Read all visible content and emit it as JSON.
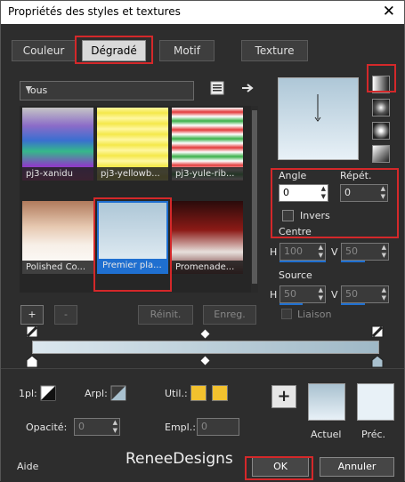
{
  "window": {
    "title": "Propriétés des styles et textures",
    "close_glyph": "✕"
  },
  "tabs": [
    {
      "label": "Couleur"
    },
    {
      "label": "Dégradé",
      "selected": true
    },
    {
      "label": "Motif"
    },
    {
      "label": "Texture"
    }
  ],
  "library": {
    "category": "Tous",
    "items": [
      {
        "label": "pj3-xanidu"
      },
      {
        "label": "pj3-yellowb..."
      },
      {
        "label": "pj3-yule-rib..."
      },
      {
        "label": "Polished Co..."
      },
      {
        "label": "Premier pla...",
        "selected": true
      },
      {
        "label": "Promenade..."
      }
    ]
  },
  "options": {
    "angle_label": "Angle",
    "angle_value": "0",
    "repeat_label": "Répét.",
    "repeat_value": "0",
    "invert_label": "Invers",
    "center_label": "Centre",
    "center_h_label": "H",
    "center_h_value": "100",
    "center_v_label": "V",
    "center_v_value": "50",
    "source_label": "Source",
    "source_h_label": "H",
    "source_h_value": "50",
    "source_v_label": "V",
    "source_v_value": "50",
    "link_label": "Liaison"
  },
  "stops": {
    "add_label": "+",
    "remove_label": "-",
    "reset_label": "Réinit.",
    "save_label": "Enreg."
  },
  "editor": {
    "opl_label": "1pl:",
    "arpl_label": "Arpl:",
    "util_label": "Util.:",
    "opacity_label": "Opacité:",
    "opacity_value": "0",
    "empl_label": "Empl.:",
    "empl_value": "0",
    "add_button": "+",
    "current_label": "Actuel",
    "prev_label": "Préc."
  },
  "footer": {
    "help_label": "Aide",
    "watermark": "ReneeDesigns",
    "ok_label": "OK",
    "cancel_label": "Annuler"
  },
  "colors": {
    "accent_red": "#d4282a",
    "selection_blue": "#1f6fd0",
    "user_color": "#f2c12e"
  }
}
